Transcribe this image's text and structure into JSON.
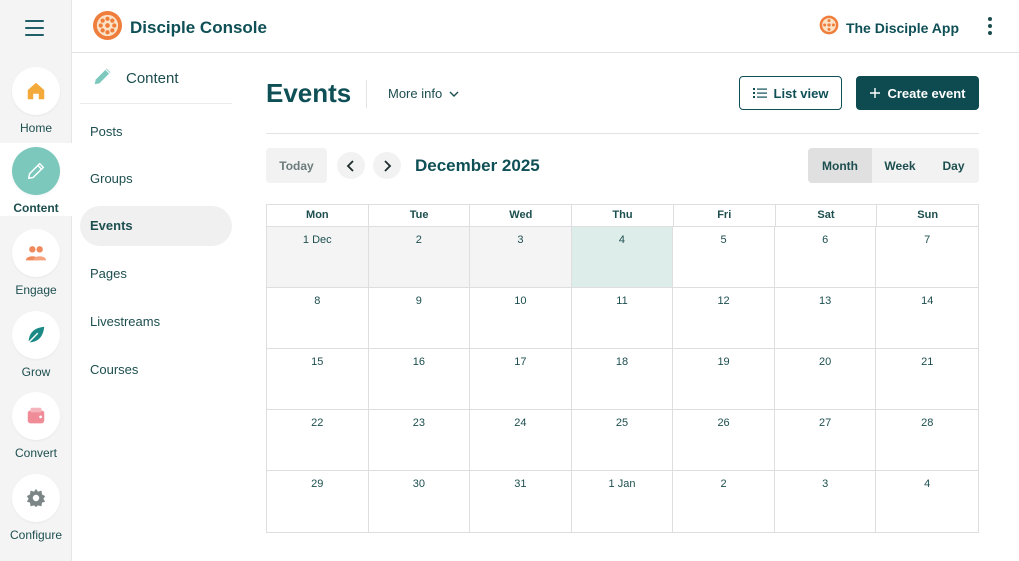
{
  "header": {
    "brand_title": "Disciple Console",
    "app_name": "The Disciple App"
  },
  "rail": {
    "items": [
      {
        "label": "Home",
        "icon": "home-icon"
      },
      {
        "label": "Content",
        "icon": "pencil-icon",
        "active": true
      },
      {
        "label": "Engage",
        "icon": "people-icon"
      },
      {
        "label": "Grow",
        "icon": "leaf-icon"
      },
      {
        "label": "Convert",
        "icon": "wallet-icon"
      },
      {
        "label": "Configure",
        "icon": "gear-icon"
      }
    ]
  },
  "subnav": {
    "title": "Content",
    "items": [
      {
        "label": "Posts"
      },
      {
        "label": "Groups"
      },
      {
        "label": "Events",
        "active": true
      },
      {
        "label": "Pages"
      },
      {
        "label": "Livestreams"
      },
      {
        "label": "Courses"
      }
    ]
  },
  "page": {
    "title": "Events",
    "more_info": "More info",
    "list_view": "List view",
    "create_event": "Create event"
  },
  "calendar": {
    "today_label": "Today",
    "month_label": "December 2025",
    "views": [
      "Month",
      "Week",
      "Day"
    ],
    "active_view": "Month",
    "weekdays": [
      "Mon",
      "Tue",
      "Wed",
      "Thu",
      "Fri",
      "Sat",
      "Sun"
    ],
    "days": [
      "1 Dec",
      "2",
      "3",
      "4",
      "5",
      "6",
      "7",
      "8",
      "9",
      "10",
      "11",
      "12",
      "13",
      "14",
      "15",
      "16",
      "17",
      "18",
      "19",
      "20",
      "21",
      "22",
      "23",
      "24",
      "25",
      "26",
      "27",
      "28",
      "29",
      "30",
      "31",
      "1 Jan",
      "2",
      "3",
      "4"
    ],
    "past_count": 3,
    "today_index": 3
  },
  "colors": {
    "primary": "#0d4b50",
    "active_rail": "#7cc8bd",
    "today_cell": "#dcedea",
    "past_cell": "#f4f4f4",
    "brand_orange": "#ef7d3c"
  }
}
